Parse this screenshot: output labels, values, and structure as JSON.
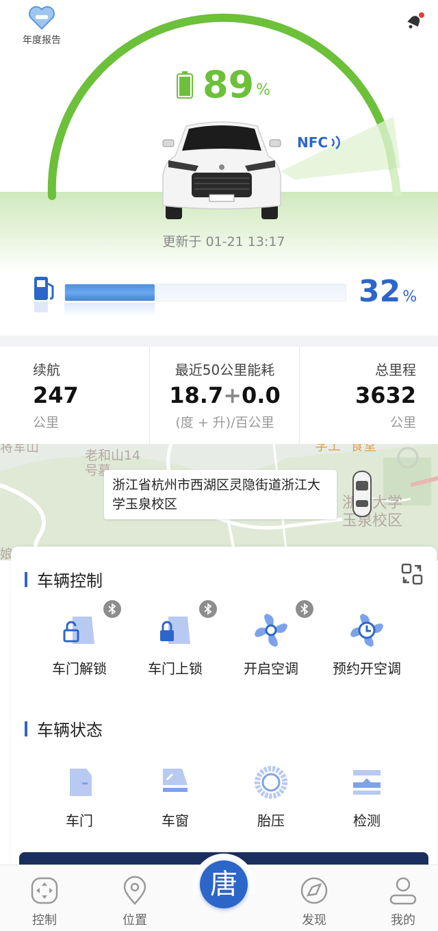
{
  "header": {
    "annual_report_label": "年度报告",
    "battery_percent": "89",
    "battery_unit": "%",
    "nfc_label": "NFC",
    "update_time": "更新于 01-21 13:17",
    "fuel_percent": "32",
    "fuel_unit": "%",
    "fuel_level": 0.32
  },
  "stats": {
    "range": {
      "title": "续航",
      "value": "247",
      "unit": "公里"
    },
    "energy": {
      "title": "最近50公里能耗",
      "value_a": "18.7",
      "plus": "+",
      "value_b": "0.0",
      "unit": "(度 + 升)/百公里"
    },
    "mileage": {
      "title": "总里程",
      "value": "3632",
      "unit": "公里"
    }
  },
  "map": {
    "address": "浙江省杭州市西湖区灵隐街道浙江大学玉泉校区",
    "labels": [
      "将军山",
      "老和山14",
      "号墓",
      "学工",
      "食堂",
      "浙江大学",
      "玉泉校区",
      "娘"
    ]
  },
  "control": {
    "title": "车辆控制",
    "items": [
      {
        "label": "车门解锁",
        "icon": "door-unlock-icon",
        "bluetooth": true
      },
      {
        "label": "车门上锁",
        "icon": "door-lock-icon",
        "bluetooth": true
      },
      {
        "label": "开启空调",
        "icon": "fan-icon",
        "bluetooth": true
      },
      {
        "label": "预约开空调",
        "icon": "fan-clock-icon",
        "bluetooth": false
      }
    ]
  },
  "status": {
    "title": "车辆状态",
    "items": [
      {
        "label": "车门",
        "icon": "door-icon"
      },
      {
        "label": "车窗",
        "icon": "window-icon"
      },
      {
        "label": "胎压",
        "icon": "tire-icon"
      },
      {
        "label": "检测",
        "icon": "diagnostics-icon"
      }
    ]
  },
  "nav": {
    "items": [
      {
        "label": "控制",
        "icon": "control-icon"
      },
      {
        "label": "位置",
        "icon": "location-icon"
      },
      {
        "label": "发现",
        "icon": "discover-icon"
      },
      {
        "label": "我的",
        "icon": "profile-icon"
      }
    ],
    "center_label": "唐"
  },
  "colors": {
    "accent_blue": "#2d66c9",
    "battery_green": "#6cc03a"
  }
}
